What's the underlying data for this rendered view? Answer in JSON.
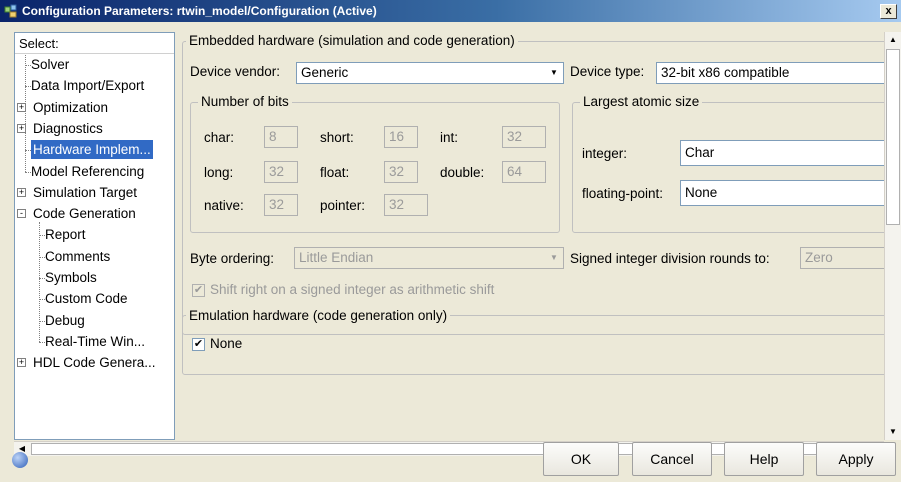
{
  "window": {
    "title": "Configuration Parameters: rtwin_model/Configuration (Active)",
    "close_label": "x"
  },
  "tree": {
    "header": "Select:",
    "items": [
      {
        "label": "Solver"
      },
      {
        "label": "Data Import/Export"
      },
      {
        "label": "Optimization",
        "expander": "+"
      },
      {
        "label": "Diagnostics",
        "expander": "+"
      },
      {
        "label": "Hardware Implem...",
        "selected": true
      },
      {
        "label": "Model Referencing"
      },
      {
        "label": "Simulation Target",
        "expander": "+"
      },
      {
        "label": "Code Generation",
        "expander": "-"
      },
      {
        "label": "Report"
      },
      {
        "label": "Comments"
      },
      {
        "label": "Symbols"
      },
      {
        "label": "Custom Code"
      },
      {
        "label": "Debug"
      },
      {
        "label": "Real-Time Win..."
      },
      {
        "label": "HDL Code Genera...",
        "expander": "+"
      }
    ]
  },
  "embedded": {
    "title": "Embedded hardware (simulation and code generation)",
    "device_vendor_label": "Device vendor:",
    "device_vendor_value": "Generic",
    "device_type_label": "Device type:",
    "device_type_value": "32-bit x86 compatible",
    "bits": {
      "title": "Number of bits",
      "char_label": "char:",
      "char_value": "8",
      "short_label": "short:",
      "short_value": "16",
      "int_label": "int:",
      "int_value": "32",
      "long_label": "long:",
      "long_value": "32",
      "float_label": "float:",
      "float_value": "32",
      "double_label": "double:",
      "double_value": "64",
      "native_label": "native:",
      "native_value": "32",
      "pointer_label": "pointer:",
      "pointer_value": "32"
    },
    "atomic": {
      "title": "Largest atomic size",
      "integer_label": "integer:",
      "integer_value": "Char",
      "float_label": "floating-point:",
      "float_value": "None"
    },
    "byte_order_label": "Byte ordering:",
    "byte_order_value": "Little Endian",
    "signed_div_label": "Signed integer division rounds to:",
    "signed_div_value": "Zero",
    "shift_label": "Shift right on a signed integer as arithmetic shift",
    "shift_checked": true
  },
  "emulation": {
    "title": "Emulation hardware (code generation only)",
    "none_label": "None",
    "none_checked": true
  },
  "footer": {
    "ok": "OK",
    "cancel": "Cancel",
    "help": "Help",
    "apply": "Apply"
  },
  "icons": {
    "app": "simulink-config-icon",
    "help": "help-globe-icon"
  }
}
